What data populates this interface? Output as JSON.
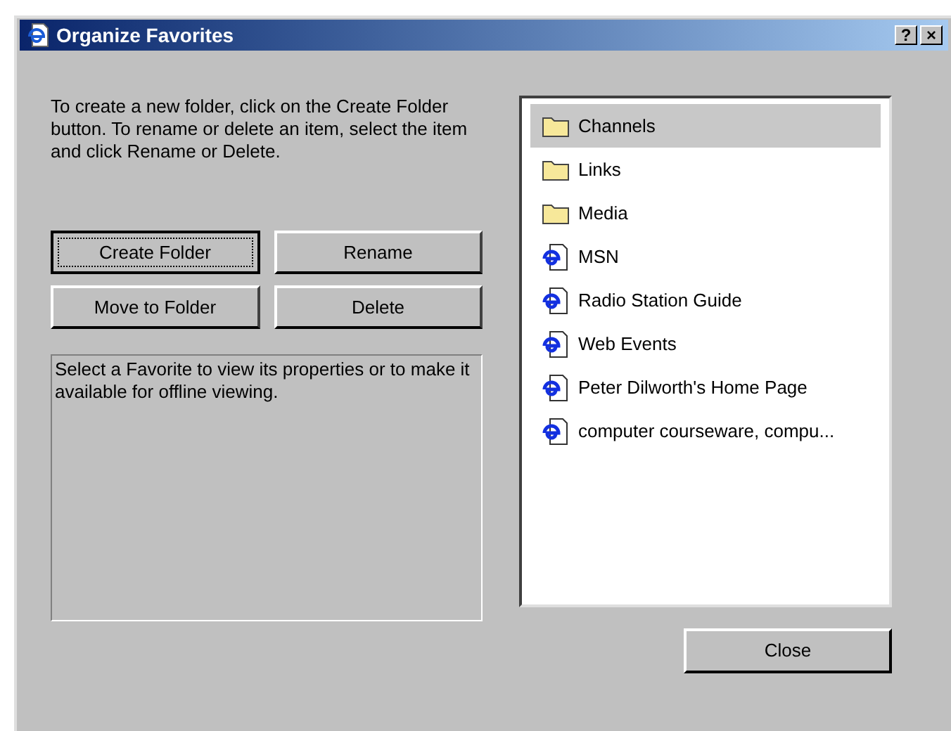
{
  "window": {
    "title": "Organize Favorites",
    "title_buttons": [
      "?",
      "×"
    ]
  },
  "instructions": "To create a new folder, click on the Create Folder button. To rename or delete an item, select the item and click Rename or Delete.",
  "buttons": [
    {
      "label": "Create Folder",
      "focused": true
    },
    {
      "label": "Rename",
      "focused": false
    },
    {
      "label": "Move to Folder",
      "focused": false
    },
    {
      "label": "Delete",
      "focused": false
    }
  ],
  "info": "Select a Favorite to view its properties or to make it available for offline viewing.",
  "favorites": [
    {
      "label": "Channels",
      "kind": "folder",
      "selected": true
    },
    {
      "label": "Links",
      "kind": "folder",
      "selected": false
    },
    {
      "label": "Media",
      "kind": "folder",
      "selected": false
    },
    {
      "label": "MSN",
      "kind": "link",
      "selected": false
    },
    {
      "label": "Radio Station Guide",
      "kind": "link",
      "selected": false
    },
    {
      "label": "Web Events",
      "kind": "link",
      "selected": false
    },
    {
      "label": "Peter Dilworth's Home Page",
      "kind": "link",
      "selected": false
    },
    {
      "label": "computer courseware, compu...",
      "kind": "link",
      "selected": false
    }
  ],
  "close_button": "Close"
}
